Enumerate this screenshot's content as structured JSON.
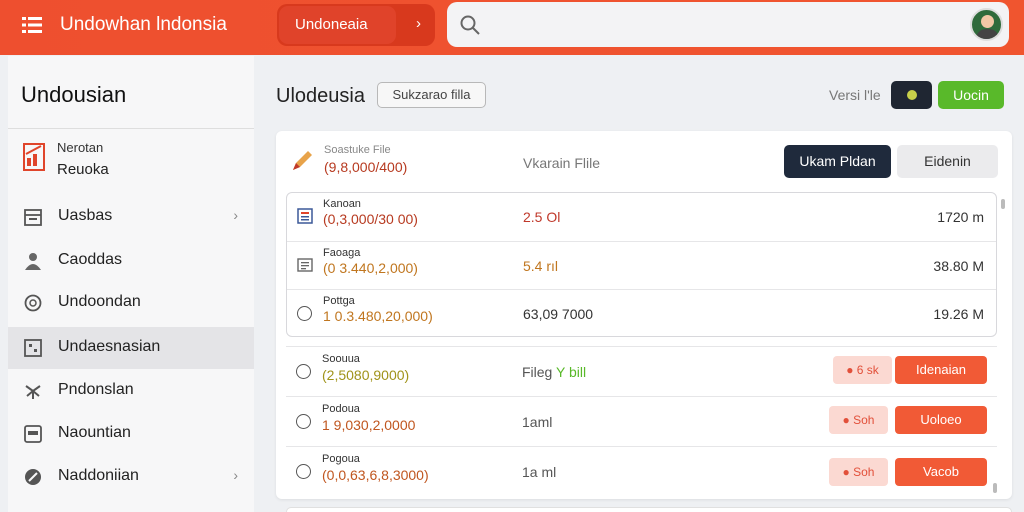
{
  "header": {
    "app_title": "Undowhan lndonsia",
    "region_label": "Undoneaia",
    "region_chevron": "›",
    "search_placeholder": ""
  },
  "sidebar": {
    "title": "Undousian",
    "top_item": {
      "line1": "Nerotan",
      "line2": "Reuoka",
      "icon": "clipboard-chart-icon"
    },
    "items": [
      {
        "label": "Uasbas",
        "icon": "calendar-icon",
        "chevron": "›",
        "active": false
      },
      {
        "label": "Caoddas",
        "icon": "user-icon",
        "chevron": "",
        "active": false
      },
      {
        "label": "Undoondan",
        "icon": "compass-icon",
        "chevron": "",
        "active": false
      },
      {
        "label": "Undaesnasian",
        "icon": "grid-box-icon",
        "chevron": "",
        "active": true
      },
      {
        "label": "Pndonslan",
        "icon": "settings-cross-icon",
        "chevron": "",
        "active": false
      },
      {
        "label": "Naountian",
        "icon": "box-icon",
        "chevron": "",
        "active": false
      },
      {
        "label": "Naddoniian",
        "icon": "leaf-icon",
        "chevron": "›",
        "active": false
      }
    ]
  },
  "main": {
    "title": "Ulodeusia",
    "filter_label": "Sukzarao filla",
    "version_label": "Versi l'le",
    "green_button": "Uocin",
    "card": {
      "head_sub": "Soastuke File",
      "head_value": "(9,8,000/400)",
      "head_mid": "Vkarain Flile",
      "primary_button": "Ukam Pldan",
      "secondary_button": "Eidenin"
    },
    "top_rows": [
      {
        "name": "Kanoan",
        "code": "(0,3,000/30 00)",
        "size": "2.5 Ol",
        "right": "1720 m",
        "icon": "document-icon",
        "code_color": "#b73a20",
        "size_color": "#c0392b"
      },
      {
        "name": "Faoaga",
        "code": "(0 3.440,2,000)",
        "size": "5.4 rıl",
        "right": "38.80 M",
        "icon": "text-doc-icon",
        "code_color": "#c0761f",
        "size_color": "#c0761f"
      },
      {
        "name": "Pottga",
        "code": "1 0.3.480,20,000)",
        "size": "63,09 7000",
        "right": "19.26 M",
        "icon": "radio-icon",
        "code_color": "#c0761f",
        "size_color": "#333"
      }
    ],
    "lower_rows": [
      {
        "name": "Soouua",
        "code": "(2,5080,9000)",
        "size": "Fileg",
        "size_extra": "Y bill",
        "pink": "6 sk",
        "red": "Idenaian",
        "code_color": "#a0931a"
      },
      {
        "name": "Podoua",
        "code": "1 9,030,2,0000",
        "size": "1aml",
        "size_extra": "",
        "pink": "Soh",
        "red": "Uoloeo",
        "code_color": "#c0561f"
      },
      {
        "name": "Pogoua",
        "code": "(0,0,63,6,8,3000)",
        "size": "1a ml",
        "size_extra": "",
        "pink": "Soh",
        "red": "Vacob",
        "code_color": "#c0561f"
      }
    ]
  },
  "colors": {
    "accent": "#ee4f2f",
    "dark": "#1f2a3c",
    "green": "#59b92a",
    "danger": "#f15a36"
  }
}
